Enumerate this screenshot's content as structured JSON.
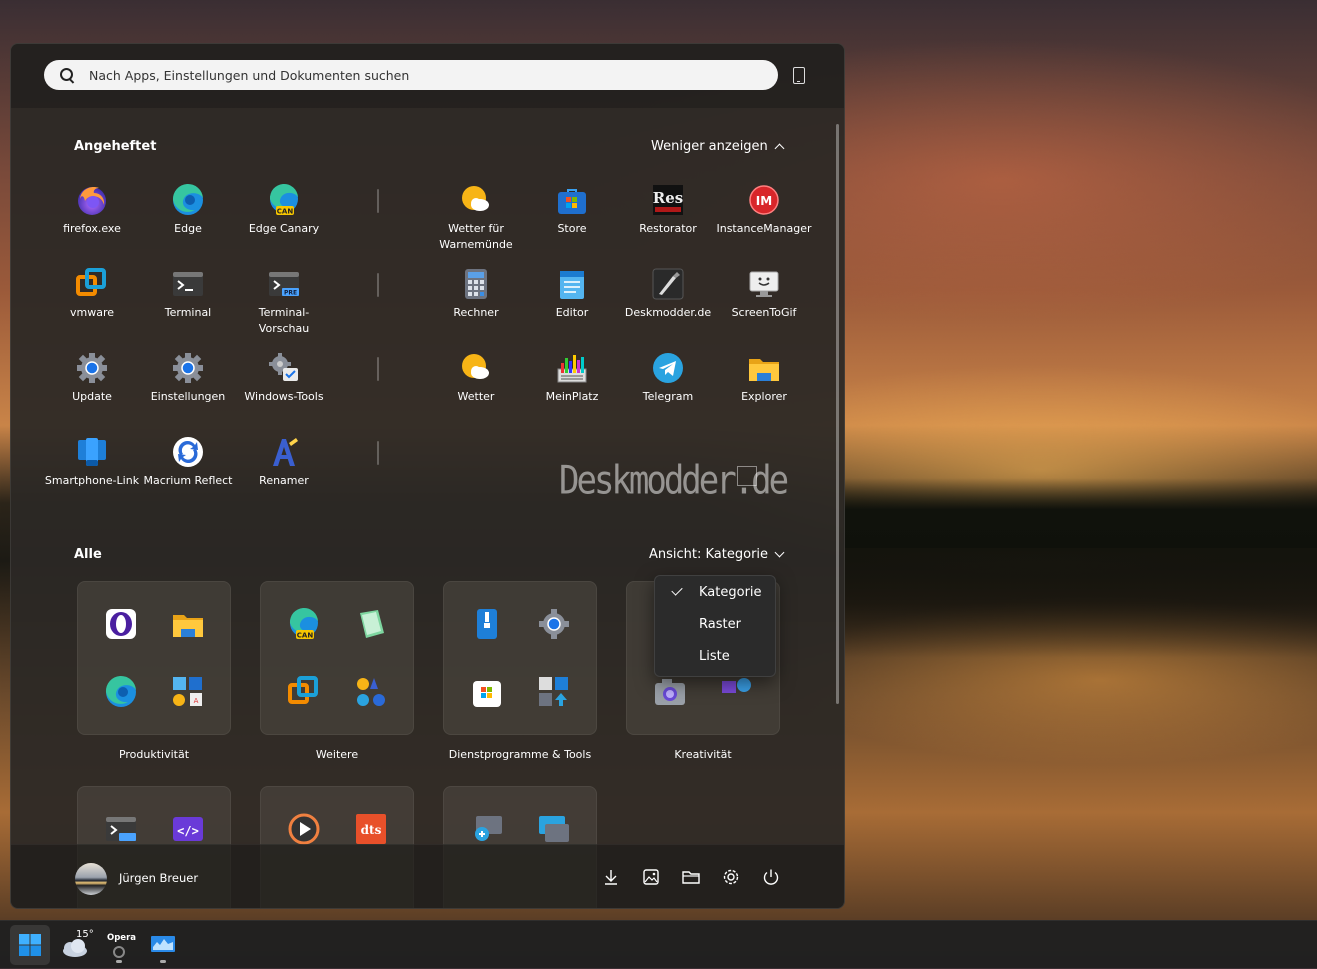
{
  "search": {
    "placeholder": "Nach Apps, Einstellungen und Dokumenten suchen"
  },
  "pinned": {
    "title": "Angeheftet",
    "toggle_label": "Weniger anzeigen",
    "items": [
      {
        "label": "firefox.exe",
        "icon": "firefox-icon"
      },
      {
        "label": "Edge",
        "icon": "edge-icon"
      },
      {
        "label": "Edge Canary",
        "icon": "edge-canary-icon"
      },
      {
        "label": "Wetter für Warnemünde",
        "icon": "weather-icon"
      },
      {
        "label": "Store",
        "icon": "store-icon"
      },
      {
        "label": "Restorator",
        "icon": "restorator-icon"
      },
      {
        "label": "InstanceManager",
        "icon": "instancemanager-icon"
      },
      {
        "label": "vmware",
        "icon": "vmware-icon"
      },
      {
        "label": "Terminal",
        "icon": "terminal-icon"
      },
      {
        "label": "Terminal-Vorschau",
        "icon": "terminal-preview-icon"
      },
      {
        "label": "Rechner",
        "icon": "calculator-icon"
      },
      {
        "label": "Editor",
        "icon": "notepad-icon"
      },
      {
        "label": "Deskmodder.de",
        "icon": "deskmodder-icon"
      },
      {
        "label": "ScreenToGif",
        "icon": "screentogif-icon"
      },
      {
        "label": "Update",
        "icon": "update-gear-icon"
      },
      {
        "label": "Einstellungen",
        "icon": "settings-gear-icon"
      },
      {
        "label": "Windows-Tools",
        "icon": "windows-tools-icon"
      },
      {
        "label": "Wetter",
        "icon": "weather-icon"
      },
      {
        "label": "MeinPlatz",
        "icon": "meinplatz-icon"
      },
      {
        "label": "Telegram",
        "icon": "telegram-icon"
      },
      {
        "label": "Explorer",
        "icon": "folder-icon"
      },
      {
        "label": "Smartphone-Link",
        "icon": "phone-link-icon"
      },
      {
        "label": "Macrium Reflect",
        "icon": "macrium-icon"
      },
      {
        "label": "Renamer",
        "icon": "renamer-icon"
      }
    ]
  },
  "watermark": "Deskmodder.de",
  "all": {
    "title": "Alle",
    "view_label": "Ansicht: Kategorie",
    "categories": [
      {
        "label": "Produktivität"
      },
      {
        "label": "Weitere"
      },
      {
        "label": "Dienstprogramme & Tools"
      },
      {
        "label": "Kreativität"
      }
    ]
  },
  "view_menu": {
    "items": [
      {
        "label": "Kategorie",
        "checked": true
      },
      {
        "label": "Raster",
        "checked": false
      },
      {
        "label": "Liste",
        "checked": false
      }
    ]
  },
  "footer": {
    "user_name": "Jürgen Breuer",
    "icons": [
      "download-icon",
      "image-icon",
      "folder-icon",
      "settings-icon",
      "power-icon"
    ]
  },
  "taskbar": {
    "weather_temp": "15°",
    "opera_label": "Opera"
  },
  "colors": {
    "panel": "#2c2825",
    "accent": "#0a84ff"
  }
}
